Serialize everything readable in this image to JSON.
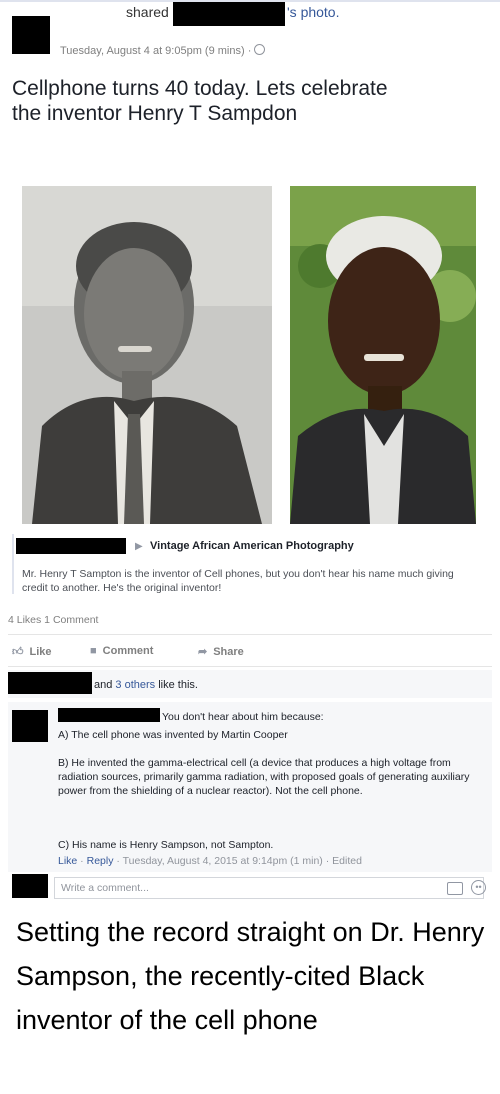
{
  "header": {
    "shared": "shared",
    "photo_suffix": "'s photo.",
    "timestamp": "Tuesday, August 4 at 9:05pm (9 mins) · "
  },
  "post": {
    "text": "Cellphone turns 40 today. Lets celebrate the inventor Henry T Sampdon"
  },
  "shared_from": {
    "page_name": "Vintage African American Photography",
    "description": "Mr. Henry T Sampton is the inventor of Cell phones, but you don't hear his name much giving credit to another. He's the original inventor!"
  },
  "stats": {
    "text": "4 Likes  1 Comment"
  },
  "actions": {
    "like": "Like",
    "comment": "Comment",
    "share": "Share"
  },
  "likes_line": {
    "and": "and ",
    "others": "3 others",
    "suffix": " like this."
  },
  "comment": {
    "intro": "You don't hear about him because:",
    "a": "A) The cell phone was invented by Martin Cooper",
    "b": "B) He invented the gamma-electrical cell (a device that produces a high voltage from radiation sources, primarily gamma radiation, with proposed goals of generating auxiliary power from the shielding of a nuclear reactor). Not the cell phone.",
    "c": "C) His name is Henry Sampson, not Sampton.",
    "like": "Like",
    "reply": "Reply",
    "meta": " · Tuesday, August 4, 2015 at 9:14pm (1 min) · Edited"
  },
  "composer": {
    "placeholder": "Write a comment..."
  },
  "caption": {
    "text": "Setting the record straight on Dr. Henry Sampson, the recently-cited Black inventor of the cell phone"
  },
  "colors": {
    "link": "#365899",
    "muted": "#7f7f7f",
    "redaction": "#000000"
  },
  "icons": [
    "globe-icon",
    "like-icon",
    "comment-icon",
    "share-icon",
    "camera-icon",
    "smiley-icon",
    "triangle-right-icon"
  ]
}
